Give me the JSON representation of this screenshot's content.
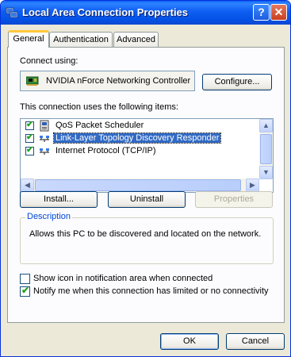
{
  "window": {
    "title": "Local Area Connection Properties",
    "help_label": "?",
    "close_label": "✕"
  },
  "tabs": [
    {
      "label": "General",
      "active": true
    },
    {
      "label": "Authentication",
      "active": false
    },
    {
      "label": "Advanced",
      "active": false
    }
  ],
  "general": {
    "connect_using_label": "Connect using:",
    "adapter_name": "NVIDIA nForce Networking Controller",
    "configure_button": "Configure...",
    "items_label": "This connection uses the following items:",
    "items": [
      {
        "label": "QoS Packet Scheduler",
        "checked": true,
        "selected": false,
        "icon": "scheduler-icon"
      },
      {
        "label": "Link-Layer Topology Discovery Responder",
        "checked": true,
        "selected": true,
        "icon": "network-protocol-icon"
      },
      {
        "label": "Internet Protocol (TCP/IP)",
        "checked": true,
        "selected": false,
        "icon": "network-protocol-icon"
      }
    ],
    "install_button": "Install...",
    "uninstall_button": "Uninstall",
    "properties_button": "Properties",
    "description_title": "Description",
    "description_text": "Allows this PC to be discovered and located on the network.",
    "show_icon_checkbox": {
      "label": "Show icon in notification area when connected",
      "checked": false
    },
    "notify_checkbox": {
      "label": "Notify me when this connection has limited or no connectivity",
      "checked": true
    }
  },
  "footer": {
    "ok_button": "OK",
    "cancel_button": "Cancel"
  },
  "colors": {
    "titlebar": "#0a5ef6",
    "dialog_bg": "#ece9d8",
    "selection": "#316ac5",
    "group_title": "#0046d5"
  }
}
